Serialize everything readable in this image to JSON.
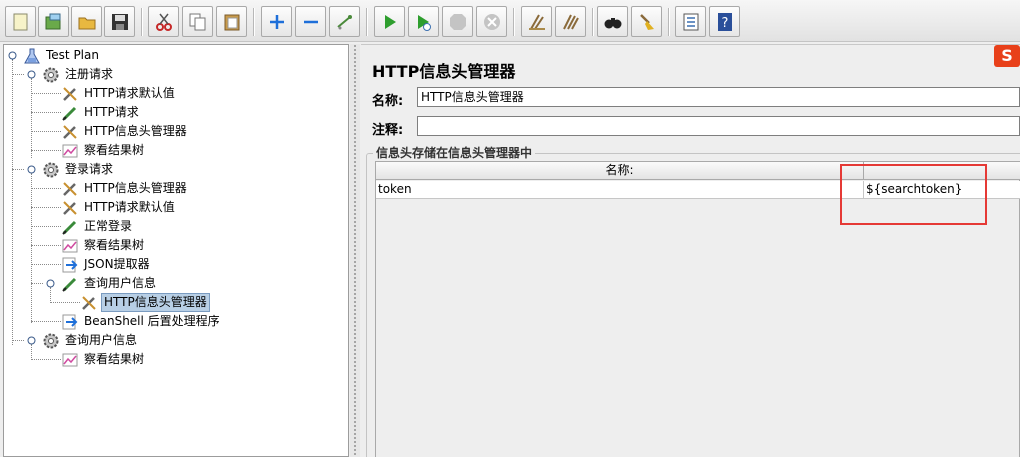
{
  "toolbar": {
    "buttons": [
      {
        "name": "new-icon",
        "color": "#f3f0c4"
      },
      {
        "name": "templates-icon",
        "color": "#4f9a3a"
      },
      {
        "name": "open-icon",
        "color": "#d9a22e"
      },
      {
        "name": "save-icon",
        "color": "#333333"
      },
      {
        "name": "cut-icon",
        "color": "#c62828"
      },
      {
        "name": "copy-icon",
        "color": "#777777"
      },
      {
        "name": "paste-icon",
        "color": "#b58a3a"
      },
      {
        "name": "expand-icon",
        "color": "#1e6fd9"
      },
      {
        "name": "collapse-icon",
        "color": "#1e6fd9"
      },
      {
        "name": "toggle-icon",
        "color": "#4a8a3a"
      },
      {
        "name": "start-icon",
        "color": "#2e9e2e"
      },
      {
        "name": "start-no-pause-icon",
        "color": "#2e9e2e"
      },
      {
        "name": "stop-icon",
        "color": "#b0b0b0"
      },
      {
        "name": "shutdown-icon",
        "color": "#b0b0b0"
      },
      {
        "name": "clear-icon",
        "color": "#8a6a3a"
      },
      {
        "name": "clear-all-icon",
        "color": "#8a6a3a"
      },
      {
        "name": "search-icon",
        "color": "#222222"
      },
      {
        "name": "reset-search-icon",
        "color": "#e0b020"
      },
      {
        "name": "function-helper-icon",
        "color": "#3a6fb0"
      },
      {
        "name": "help-icon",
        "color": "#2a4f9a"
      }
    ]
  },
  "tree": {
    "test_plan": "Test Plan",
    "register": {
      "label": "注册请求",
      "children": [
        "HTTP请求默认值",
        "HTTP请求",
        "HTTP信息头管理器",
        "察看结果树"
      ]
    },
    "login": {
      "label": "登录请求",
      "children": [
        "HTTP信息头管理器",
        "HTTP请求默认值",
        "正常登录",
        "察看结果树",
        "JSON提取器"
      ],
      "query_sampler": "查询用户信息",
      "query_child": "HTTP信息头管理器",
      "beanshell": "BeanShell 后置处理程序"
    },
    "query": {
      "label": "查询用户信息",
      "children": [
        "察看结果树"
      ]
    }
  },
  "panel": {
    "title": "HTTP信息头管理器",
    "logo": "S",
    "name_label": "名称:",
    "name_value": "HTTP信息头管理器",
    "comment_label": "注释:",
    "comment_value": "",
    "group_title": "信息头存储在信息头管理器中",
    "table": {
      "headers": [
        "名称:",
        ""
      ],
      "rows": [
        [
          "token",
          "${searchtoken}"
        ]
      ]
    }
  },
  "colors": {
    "selection": "#b8cfe5",
    "highlight": "#e53935"
  }
}
